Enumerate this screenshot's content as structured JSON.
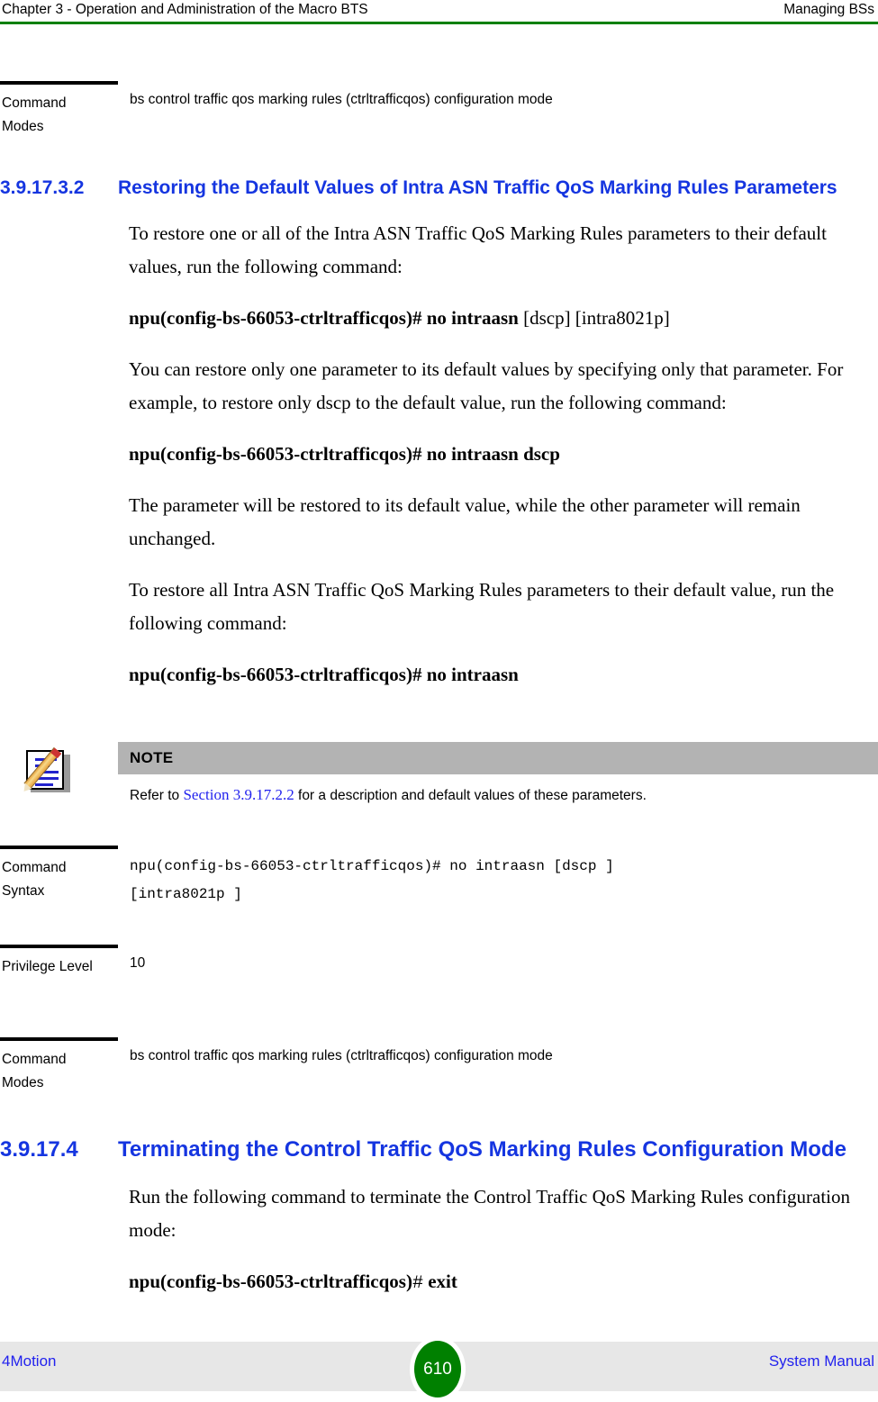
{
  "header": {
    "left": "Chapter 3 - Operation and Administration of the Macro BTS",
    "right": "Managing BSs",
    "rule_color": "#008000"
  },
  "top_table": {
    "rows": [
      {
        "label": "Command Modes",
        "value": "bs control traffic qos marking rules (ctrltrafficqos) configuration mode"
      }
    ]
  },
  "section_1": {
    "number": "3.9.17.3.2",
    "title": "Restoring the Default Values of Intra ASN Traffic QoS Marking Rules Parameters",
    "color": "#1535e0",
    "paragraph_1": "To restore one or all of the Intra ASN Traffic QoS Marking Rules parameters to their default values, run the following command:",
    "command_1_bold": "npu(config-bs-66053-ctrltrafficqos)# no intraasn",
    "command_1_optional": "[dscp] [intra8021p]",
    "paragraph_2": "You can restore only one parameter to its default values by specifying only that parameter. For example, to restore only dscp to the default value, run the following command:",
    "command_2_bold": "npu(config-bs-66053-ctrltrafficqos)# no intraasn dscp",
    "paragraph_3": "The parameter will be restored to its default value, while the other parameter will remain unchanged.",
    "paragraph_4": "To restore all Intra ASN Traffic QoS Marking Rules parameters to their default value, run the following command:",
    "command_3_bold": "npu(config-bs-66053-ctrltrafficqos)# no intraasn"
  },
  "note": {
    "icon": "note-pencil-icon",
    "title": "NOTE",
    "text_before": "Refer to ",
    "xref": "Section 3.9.17.2.2",
    "text_after": " for a description and default values of these parameters.",
    "bar_color": "#b3b3b3",
    "xref_color": "#2222ee"
  },
  "spec_table": {
    "rows": [
      {
        "label": "Command Syntax",
        "value_lines": [
          "npu(config-bs-66053-ctrltrafficqos)# no intraasn [dscp ]",
          "[intra8021p ]"
        ],
        "mono": true
      },
      {
        "label": "Privilege Level",
        "value_lines": [
          "10"
        ],
        "mono": false
      },
      {
        "label": "Command Modes",
        "value_lines": [
          "bs control traffic qos marking rules (ctrltrafficqos) configuration mode"
        ],
        "mono": false
      }
    ]
  },
  "section_2": {
    "number": "3.9.17.4",
    "title": "Terminating the Control Traffic QoS Marking Rules Configuration Mode",
    "color": "#1535e0",
    "paragraph_1": "Run the following command to terminate the Control Traffic QoS Marking Rules configuration mode:",
    "command_prompt": "npu(config-bs-66053-ctrltrafficqos)",
    "command_hash": "#",
    "command_arg": "exit"
  },
  "footer": {
    "left": "4Motion",
    "page_number": "610",
    "right": "System Manual",
    "bubble_color": "#008000",
    "band_color": "#e7e7e7",
    "link_color": "#2222ee"
  }
}
